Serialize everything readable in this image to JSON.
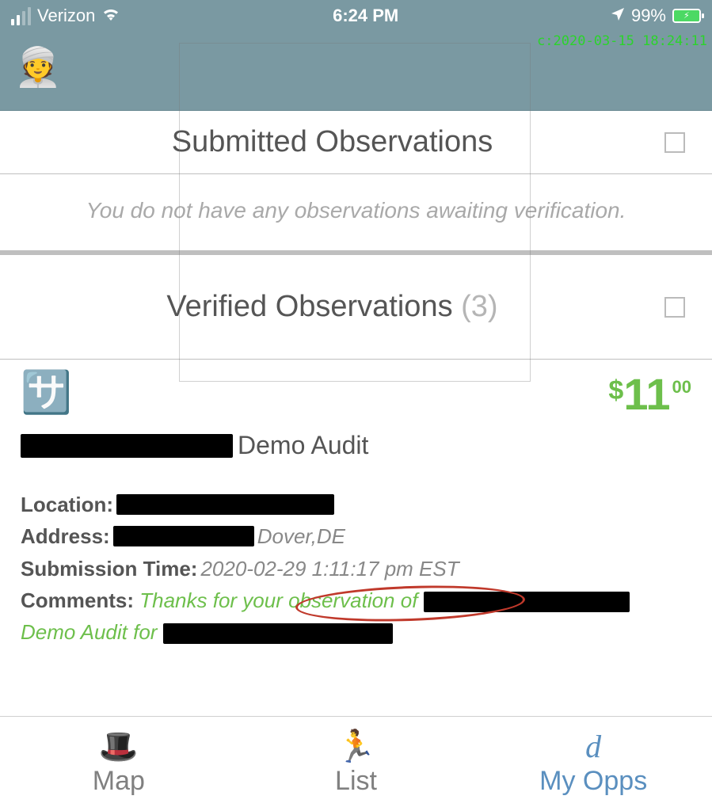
{
  "status": {
    "carrier": "Verizon",
    "time": "6:24 PM",
    "battery_pct": "99%"
  },
  "header": {
    "avatar_emoji": "👳",
    "debug_ts": "c:2020-03-15 18:24:11"
  },
  "sections": {
    "submitted": {
      "title": "Submitted Observations",
      "empty_msg": "You do not have any observations awaiting verification."
    },
    "verified": {
      "title": "Verified Observations",
      "count": "(3)"
    }
  },
  "observation": {
    "icon_emoji": "🈂️",
    "price_currency": "$",
    "price_whole": "11",
    "price_cents": "00",
    "title_suffix": "Demo Audit",
    "location_label": "Location:",
    "address_label": "Address:",
    "address_city": "Dover,DE",
    "submission_label": "Submission Time:",
    "submission_value": "2020-02-29 1:11:17 pm EST",
    "comments_label": "Comments:",
    "comments_prefix": "Thanks for your observation of",
    "comments_line2_prefix": "Demo Audit for"
  },
  "tabs": {
    "map": "Map",
    "list": "List",
    "myopps": "My Opps",
    "myopps_glyph": "d"
  }
}
